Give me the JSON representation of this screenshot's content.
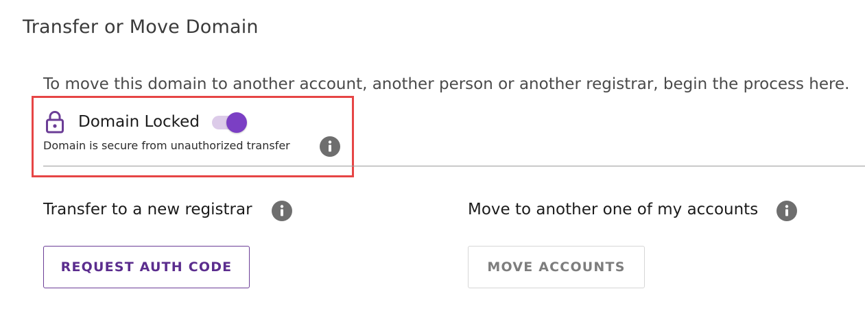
{
  "page": {
    "title": "Transfer or Move Domain",
    "intro": "To move this domain to another account, another person or another registrar, begin the process here."
  },
  "domain_lock": {
    "label": "Domain Locked",
    "toggle_on": true,
    "description": "Domain is secure from unauthorized transfer",
    "icon": "lock-icon",
    "info_icon": "info-icon"
  },
  "transfer": {
    "title": "Transfer to a new registrar",
    "button_label": "REQUEST AUTH CODE"
  },
  "move": {
    "title": "Move to another one of my accounts",
    "button_label": "MOVE ACCOUNTS"
  },
  "colors": {
    "accent": "#7b3fc4",
    "toggle_track": "#dccbe9",
    "highlight_border": "#e64545",
    "info_icon": "#6e6e6e",
    "primary_button_text": "#5b2d8e",
    "disabled_button_text": "#7d7d7d"
  }
}
